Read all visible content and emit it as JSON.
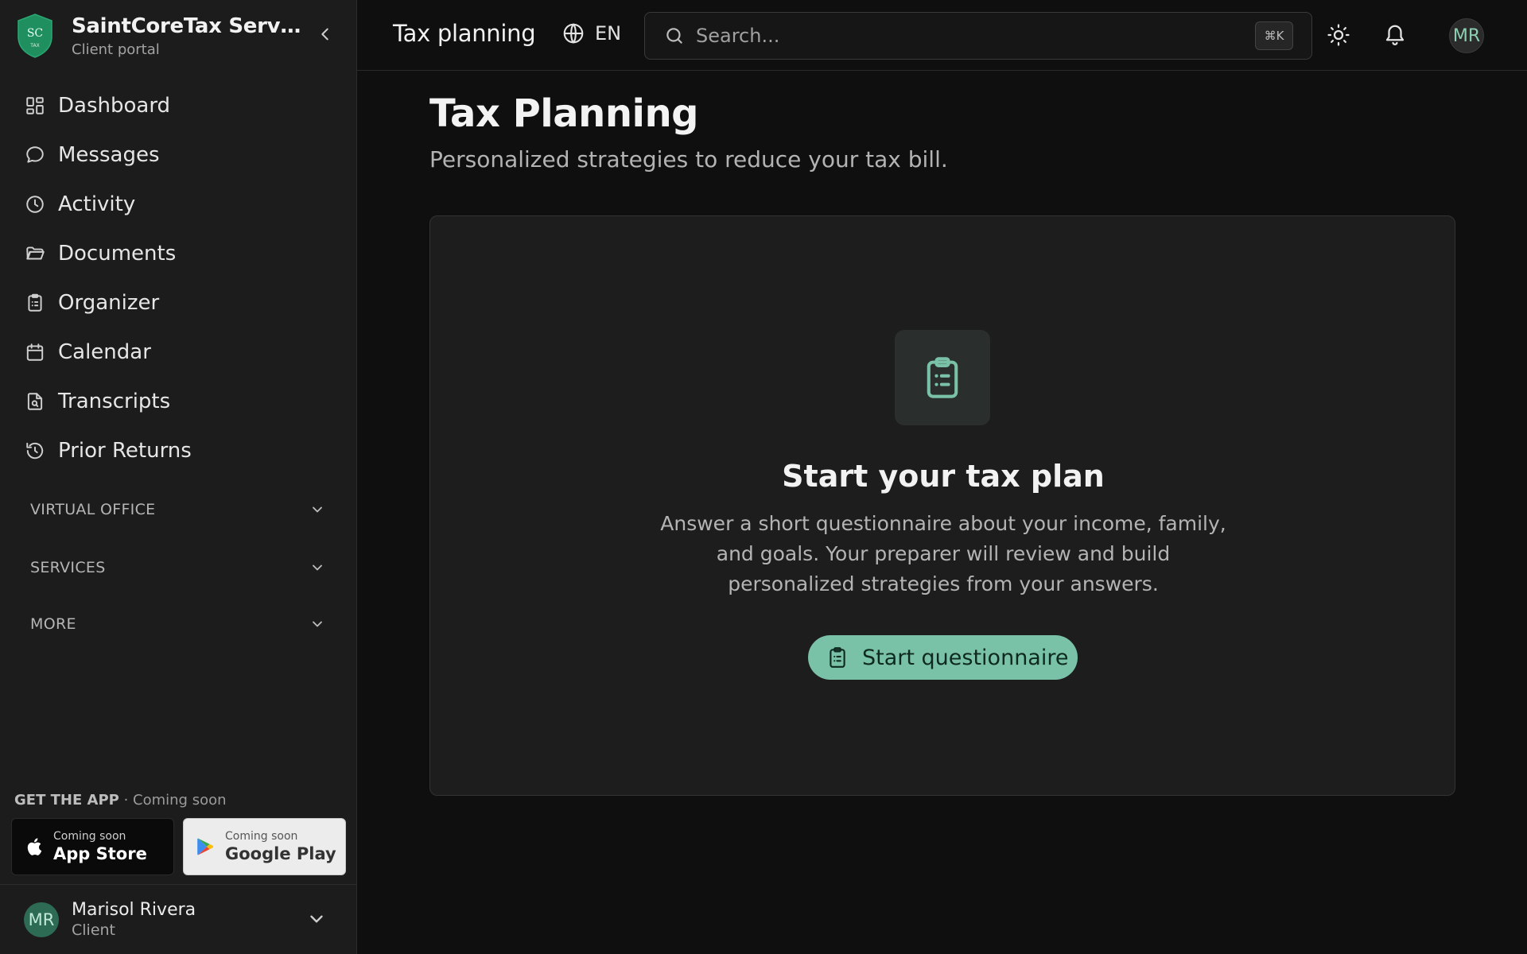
{
  "brand": {
    "name": "SaintCoreTax Services",
    "subtitle": "Client portal",
    "logo_top": "SC",
    "logo_bottom": "TAX"
  },
  "nav": {
    "items": [
      {
        "label": "Dashboard",
        "icon": "dashboard-icon"
      },
      {
        "label": "Messages",
        "icon": "message-icon"
      },
      {
        "label": "Activity",
        "icon": "clock-icon"
      },
      {
        "label": "Documents",
        "icon": "folder-icon"
      },
      {
        "label": "Organizer",
        "icon": "clipboard-icon"
      },
      {
        "label": "Calendar",
        "icon": "calendar-icon"
      },
      {
        "label": "Transcripts",
        "icon": "file-search-icon"
      },
      {
        "label": "Prior Returns",
        "icon": "history-icon"
      }
    ]
  },
  "sections": {
    "virtual_office": "VIRTUAL OFFICE",
    "services": "SERVICES",
    "more": "MORE"
  },
  "app_promo": {
    "heading": "GET THE APP",
    "note": "· Coming soon",
    "apple": {
      "small": "Coming soon",
      "big": "App Store"
    },
    "google": {
      "small": "Coming soon",
      "big": "Google Play"
    }
  },
  "user": {
    "initials": "MR",
    "name": "Marisol Rivera",
    "role": "Client"
  },
  "topbar": {
    "title": "Tax planning",
    "lang": "EN",
    "search_placeholder": "Search...",
    "shortcut": "⌘K",
    "avatar_initials": "MR"
  },
  "page": {
    "title": "Tax Planning",
    "subtitle": "Personalized strategies to reduce your tax bill."
  },
  "empty_state": {
    "title": "Start your tax plan",
    "description": "Answer a short questionnaire about your income, family, and goals. Your preparer will review and build personalized strategies from your answers.",
    "cta": "Start questionnaire"
  },
  "colors": {
    "accent": "#7ac2a7",
    "brand_green": "#1f8f5f",
    "sidebar_bg": "#1c1c1c",
    "main_bg": "#0f0f0f"
  }
}
